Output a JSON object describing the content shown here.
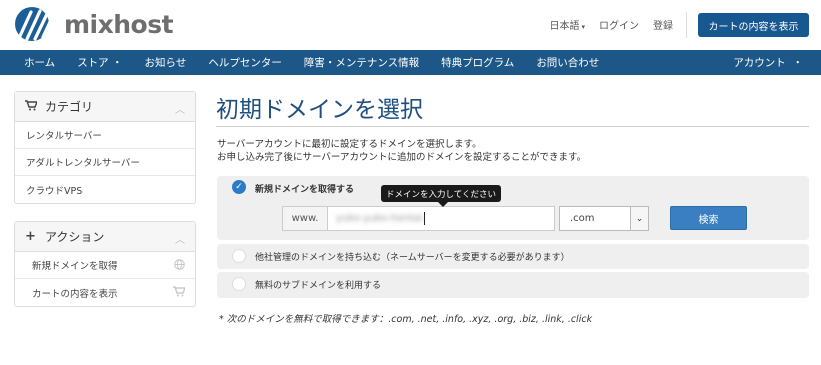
{
  "header": {
    "logo_text": "mixhost",
    "language_label": "日本語",
    "login_label": "ログイン",
    "register_label": "登録",
    "cart_button_label": "カートの内容を表示"
  },
  "nav": {
    "items": [
      "ホーム",
      "ストア",
      "お知らせ",
      "ヘルプセンター",
      "障害・メンテナンス情報",
      "特典プログラム",
      "お問い合わせ"
    ],
    "store_caret": "・",
    "account_label": "アカウント",
    "account_caret": "・"
  },
  "sidebar": {
    "categories": {
      "title": "カテゴリ",
      "items": [
        "レンタルサーバー",
        "アダルトレンタルサーバー",
        "クラウドVPS"
      ]
    },
    "actions": {
      "title": "アクション",
      "items": [
        "新規ドメインを取得",
        "カートの内容を表示"
      ]
    }
  },
  "main": {
    "title": "初期ドメインを選択",
    "intro_line1": "サーバーアカウントに最初に設定するドメインを選択します。",
    "intro_line2": "お申し込み完了後にサーバーアカウントに追加のドメインを設定することができます。",
    "option_register_label": "新規ドメインを取得する",
    "www_prefix": "www.",
    "domain_input_value": "yuko-yuko-hentai",
    "tld_selected": ".com",
    "search_button_label": "検索",
    "tooltip_text": "ドメインを入力してください",
    "option_transfer_label": "他社管理のドメインを持ち込む（ネームサーバーを変更する必要があります）",
    "option_subdomain_label": "無料のサブドメインを利用する",
    "note": "* 次のドメインを無料で取得できます：.com, .net, .info, .xyz, .org, .biz, .link, .click"
  },
  "colors": {
    "brand": "#175891",
    "nav_bg": "#1c5787",
    "title": "#1e4f80",
    "radio_active": "#2c7bc6",
    "search_button": "#3a7fc1"
  },
  "icons": {
    "logo": "mixhost-stripes-logo",
    "cart": "cart-icon",
    "plus": "plus-icon",
    "globe": "globe-icon",
    "check": "check-icon",
    "chevron_up": "chevron-up-icon",
    "chevron_down": "chevron-down-icon"
  }
}
